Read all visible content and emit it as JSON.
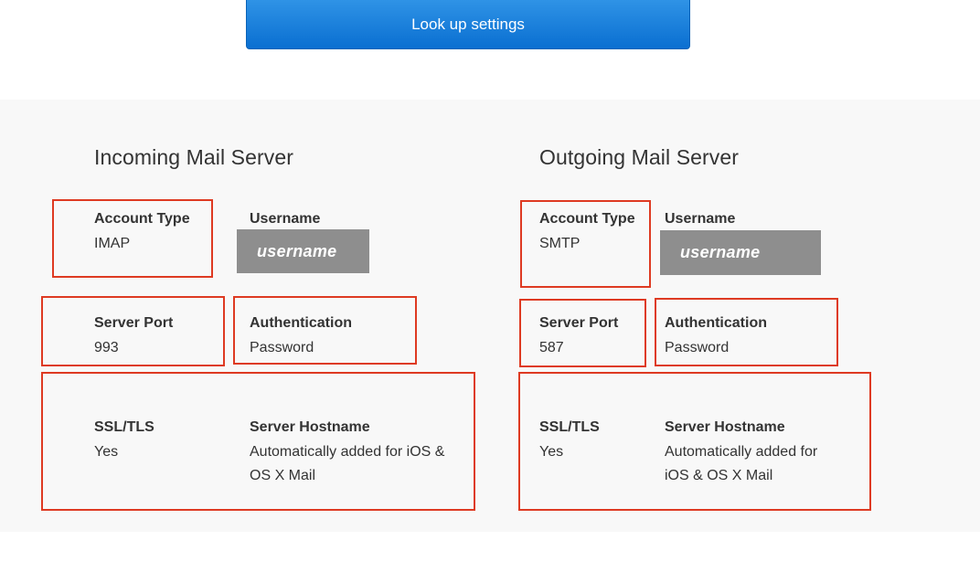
{
  "lookup_button": {
    "label": "Look up settings"
  },
  "incoming": {
    "title": "Incoming Mail Server",
    "account_type": {
      "label": "Account Type",
      "value": "IMAP"
    },
    "username": {
      "label": "Username",
      "value": "username"
    },
    "server_port": {
      "label": "Server Port",
      "value": "993"
    },
    "authentication": {
      "label": "Authentication",
      "value": "Password"
    },
    "ssl_tls": {
      "label": "SSL/TLS",
      "value": "Yes"
    },
    "server_hostname": {
      "label": "Server Hostname",
      "value_line1": "Automatically added for iOS &",
      "value_line2": "OS X Mail"
    }
  },
  "outgoing": {
    "title": "Outgoing Mail Server",
    "account_type": {
      "label": "Account Type",
      "value": "SMTP"
    },
    "username": {
      "label": "Username",
      "value": "username"
    },
    "server_port": {
      "label": "Server Port",
      "value": "587"
    },
    "authentication": {
      "label": "Authentication",
      "value": "Password"
    },
    "ssl_tls": {
      "label": "SSL/TLS",
      "value": "Yes"
    },
    "server_hostname": {
      "label": "Server Hostname",
      "value_line1": "Automatically added for",
      "value_line2": "iOS & OS X Mail"
    }
  },
  "colors": {
    "highlight_border": "#de3a22",
    "button_blue": "#1a7fd9",
    "panel_background": "#f8f8f8",
    "username_redaction": "#8e8e8e"
  }
}
